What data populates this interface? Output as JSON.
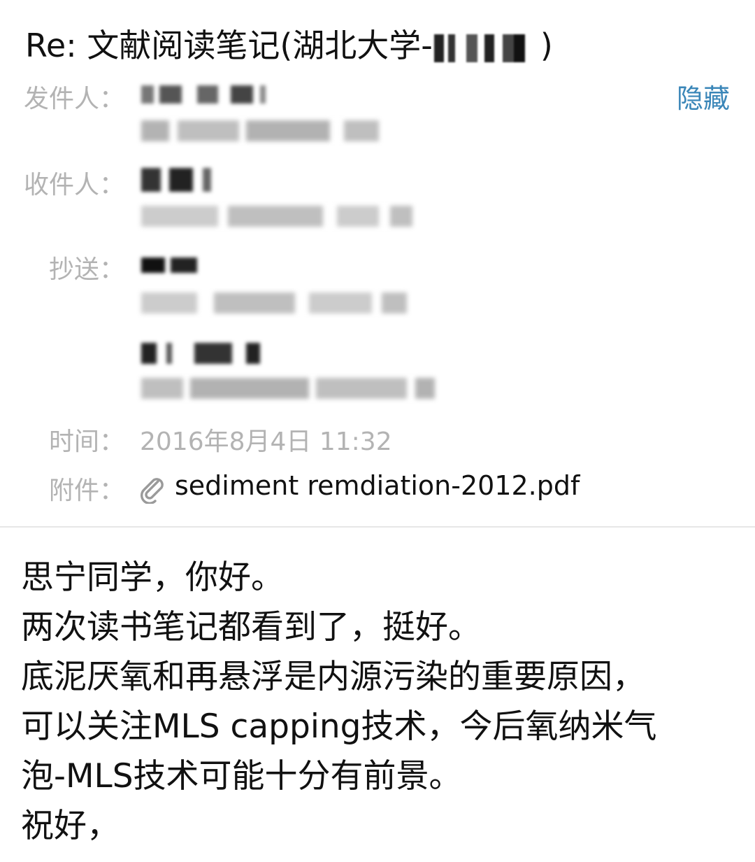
{
  "email": {
    "subject_prefix": "Re: 文献阅读笔记(湖北大学-",
    "subject_suffix": ")",
    "hide_label": "隐藏",
    "labels": {
      "from": "发件人：",
      "to": "收件人：",
      "cc": "抄送：",
      "time": "时间：",
      "attachment": "附件："
    },
    "time_value": "2016年8月4日 11:32",
    "attachment_name": "sediment remdiation-2012.pdf",
    "body_lines": [
      "思宁同学，你好。",
      "两次读书笔记都看到了，挺好。",
      "底泥厌氧和再悬浮是内源污染的重要原因，",
      "可以关注MLS capping技术，今后氧纳米气",
      "泡-MLS技术可能十分有前景。",
      "祝好，"
    ]
  },
  "colors": {
    "link": "#3a86b8",
    "label_gray": "#b3b3b3",
    "text": "#111111"
  },
  "icons": [
    "paperclip-icon"
  ]
}
